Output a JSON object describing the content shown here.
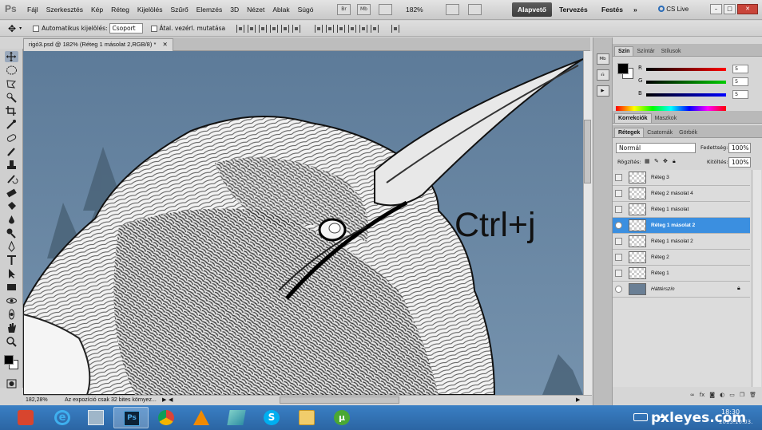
{
  "menubar": {
    "logo": "Ps",
    "items": [
      "Fájl",
      "Szerkesztés",
      "Kép",
      "Réteg",
      "Kijelölés",
      "Szűrő",
      "Elemzés",
      "3D",
      "Nézet",
      "Ablak",
      "Súgó"
    ],
    "icons": [
      "Br",
      "Mb"
    ],
    "zoom": "182%",
    "workspaces": {
      "active": "Alapvető",
      "design": "Tervezés",
      "painting": "Festés",
      "more": "»"
    },
    "cs_live": "CS Live"
  },
  "options": {
    "auto_select_label": "Automatikus kijelölés:",
    "auto_select_value": "Csoport",
    "transform_label": "Átal. vezérl. mutatása"
  },
  "document": {
    "tab_title": "rigó3.psd @ 182% (Réteg 1 másolat 2,RGB/8) *",
    "overlay_text": "Ctrl+j",
    "status_zoom": "182,28%",
    "status_message": "Az expozíció csak 32 bites környez..."
  },
  "color_panel": {
    "tabs": [
      "Szín",
      "Színtár",
      "Stílusok"
    ],
    "channels": [
      {
        "label": "R",
        "value": "5",
        "color": "#e02020"
      },
      {
        "label": "G",
        "value": "5",
        "color": "#20b020"
      },
      {
        "label": "B",
        "value": "5",
        "color": "#2030e0"
      }
    ]
  },
  "adjust_panel": {
    "tabs": [
      "Korrekciók",
      "Maszkok"
    ]
  },
  "layers_panel": {
    "tabs": [
      "Rétegek",
      "Csatornák",
      "Görbék"
    ],
    "blend_mode": "Normál",
    "opacity_label": "Fedettség:",
    "opacity_value": "100%",
    "lock_label": "Rögzítés:",
    "fill_label": "Kitöltés:",
    "fill_value": "100%",
    "layers": [
      {
        "name": "Réteg 3",
        "visible": false,
        "selected": false
      },
      {
        "name": "Réteg 2 másolat 4",
        "visible": false,
        "selected": false
      },
      {
        "name": "Réteg 1 másolat",
        "visible": false,
        "selected": false
      },
      {
        "name": "Réteg 1 másolat 2",
        "visible": true,
        "selected": true
      },
      {
        "name": "Réteg 1 másolat 2",
        "visible": false,
        "selected": false
      },
      {
        "name": "Réteg 2",
        "visible": false,
        "selected": false
      },
      {
        "name": "Réteg 1",
        "visible": false,
        "selected": false
      },
      {
        "name": "Háttérszín",
        "visible": true,
        "selected": false
      }
    ]
  },
  "taskbar": {
    "apps": [
      "power-icon",
      "internet-explorer-icon",
      "calculator-icon",
      "photoshop-icon",
      "chrome-icon",
      "vlc-icon",
      "notes-icon",
      "skype-icon",
      "file-explorer-icon",
      "utorrent-icon"
    ],
    "clock": "18:30",
    "date": "2013.10.03.",
    "watermark": "pxleyes.com"
  }
}
